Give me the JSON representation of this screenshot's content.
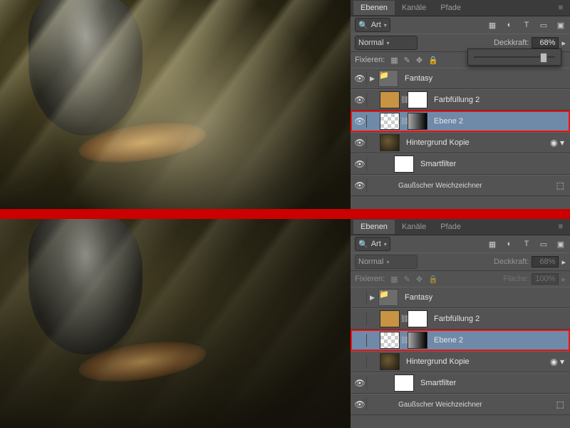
{
  "tabs": {
    "layers": "Ebenen",
    "channels": "Kanäle",
    "paths": "Pfade"
  },
  "filter": {
    "label": "Art",
    "search_icon": "search"
  },
  "iconbar": [
    "image",
    "adjustments",
    "type",
    "shape",
    "smartobj",
    "artboard"
  ],
  "blend": {
    "mode": "Normal",
    "opacity_label": "Deckkraft:"
  },
  "opacity": {
    "top": "68%",
    "bottom": "68%"
  },
  "lock": {
    "label": "Fixieren:"
  },
  "fill": {
    "label": "Fläche:",
    "value": "100%"
  },
  "layers_list": [
    {
      "kind": "group",
      "name": "Fantasy",
      "vis": true
    },
    {
      "kind": "fill",
      "name": "Farbfüllung 2",
      "vis": true
    },
    {
      "kind": "masked",
      "name": "Ebene 2",
      "vis": true,
      "selected": true,
      "highlight": true
    },
    {
      "kind": "smart",
      "name": "Hintergrund Kopie",
      "vis": true
    },
    {
      "kind": "smartsub",
      "name": "Smartfilter",
      "vis": true
    },
    {
      "kind": "filter",
      "name": "Gaußscher Weichzeichner",
      "vis": true
    }
  ],
  "bottom_layers": [
    {
      "kind": "group",
      "name": "Fantasy",
      "vis": false
    },
    {
      "kind": "fill",
      "name": "Farbfüllung 2",
      "vis": false
    },
    {
      "kind": "masked",
      "name": "Ebene 2",
      "vis": false,
      "selected": true,
      "highlight": true
    },
    {
      "kind": "smart",
      "name": "Hintergrund Kopie",
      "vis": false
    },
    {
      "kind": "smartsub",
      "name": "Smartfilter",
      "vis": true
    },
    {
      "kind": "filter",
      "name": "Gaußscher Weichzeichner",
      "vis": true
    }
  ]
}
